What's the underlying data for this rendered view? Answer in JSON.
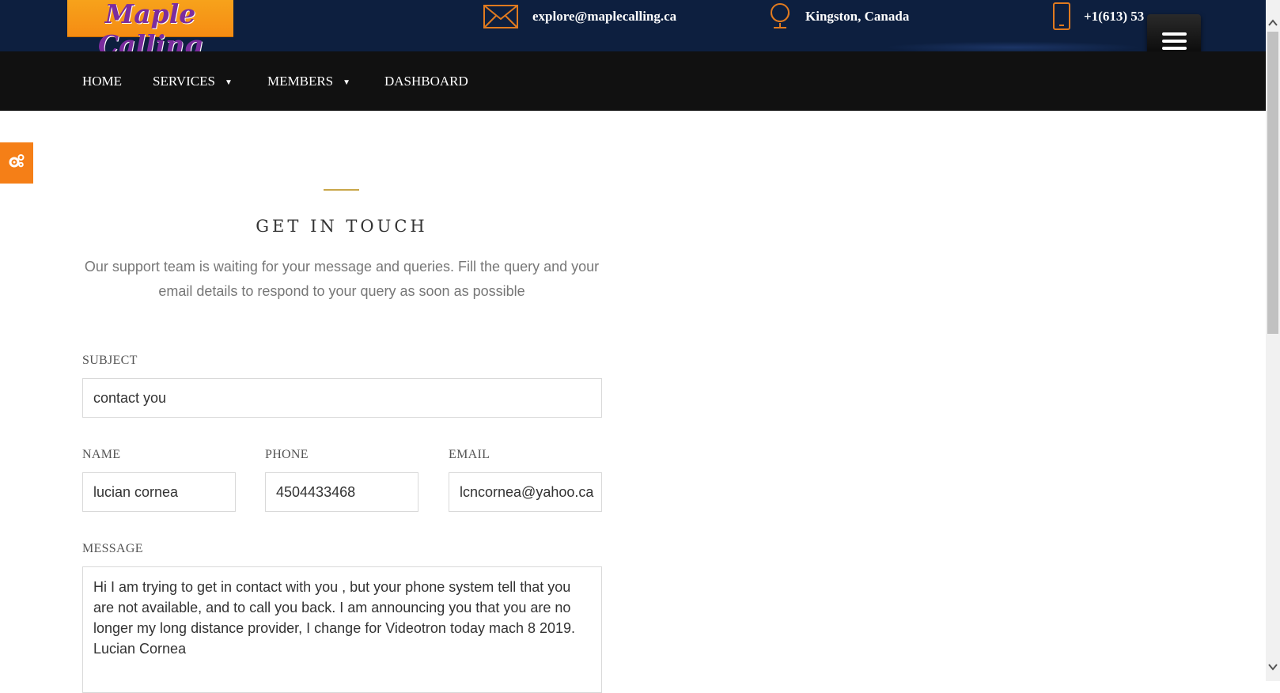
{
  "header": {
    "logo_text": "Maple Calling",
    "email": "explore@maplecalling.ca",
    "location": "Kingston, Canada",
    "phone": "+1(613) 53",
    "icons": [
      "envelope-icon",
      "globe-icon",
      "mobile-phone-icon",
      "hamburger-menu-icon"
    ],
    "colors": {
      "top_bar": "#0d1f3f",
      "accent": "#f57f17"
    }
  },
  "nav": {
    "items": [
      {
        "label": "HOME",
        "has_caret": false
      },
      {
        "label": "SERVICES",
        "has_caret": true
      },
      {
        "label": "MEMBERS",
        "has_caret": true
      },
      {
        "label": "DASHBOARD",
        "has_caret": false
      }
    ],
    "caret": "▼"
  },
  "side_tab": {
    "icon": "gears-icon"
  },
  "contact": {
    "title": "GET IN TOUCH",
    "description": "Our support team is waiting for your message and queries. Fill the query and your email details to respond to your query as soon as possible",
    "fields": {
      "subject": {
        "label": "SUBJECT",
        "value": "contact you"
      },
      "name": {
        "label": "NAME",
        "value": "lucian cornea"
      },
      "phone": {
        "label": "PHONE",
        "value": "4504433468"
      },
      "email": {
        "label": "EMAIL",
        "value": "lcncornea@yahoo.ca"
      },
      "message": {
        "label": "MESSAGE",
        "value": "Hi I am trying to get in contact with you , but your phone system tell that you are not available, and to call you back. I am announcing you that you are no longer my long distance provider, I change for Videotron today mach 8 2019.\nLucian Cornea"
      }
    }
  }
}
